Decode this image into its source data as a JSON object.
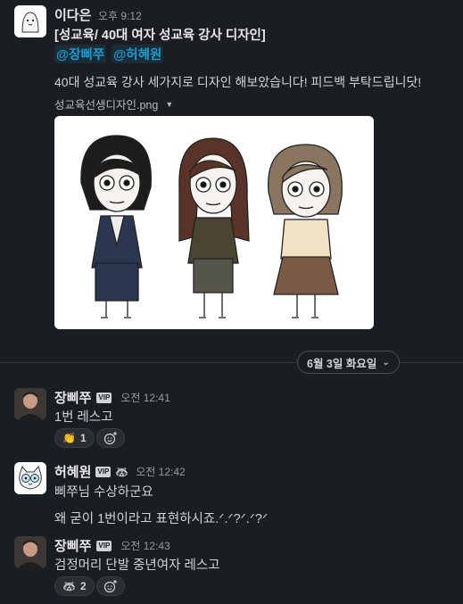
{
  "messages": [
    {
      "author": "이다은",
      "time": "오후 9:12",
      "title": "[성교육/ 40대 여자 성교육 강사 디자인]",
      "mentions": [
        "@장삐쭈",
        "@허혜원"
      ],
      "text": "40대 성교육 강사 세가지로 디자인 해보았습니다! 피드백 부탁드립니닷!",
      "file_name": "성교육선생디자인.png",
      "image_alt": "three character designs"
    }
  ],
  "date_divider": "6월 3일 화요일",
  "thread": [
    {
      "author": "장삐쭈",
      "badge": "VIP",
      "time": "오전 12:41",
      "text": "1번 레스고",
      "reaction_emoji": "👏",
      "reaction_count": "1"
    },
    {
      "author": "허혜원",
      "badge": "VIP",
      "badge2": "🦝",
      "time": "오전 12:42",
      "text1": "삐쭈님 수상하군요",
      "text2": "왜 굳이 1번이라고 표현하시죠.ᐟ.ᐟ?ᐟ.ᐟ?ᐟ"
    },
    {
      "author": "장삐쭈",
      "badge": "VIP",
      "time": "오전 12:43",
      "text": "검정머리 단발 중년여자 레스고",
      "reaction_emoji": "🦝",
      "reaction_count": "2"
    }
  ],
  "colors": {
    "bg": "#1a1d21",
    "mention": "#1d9bd1",
    "text": "#d1d2d3"
  }
}
